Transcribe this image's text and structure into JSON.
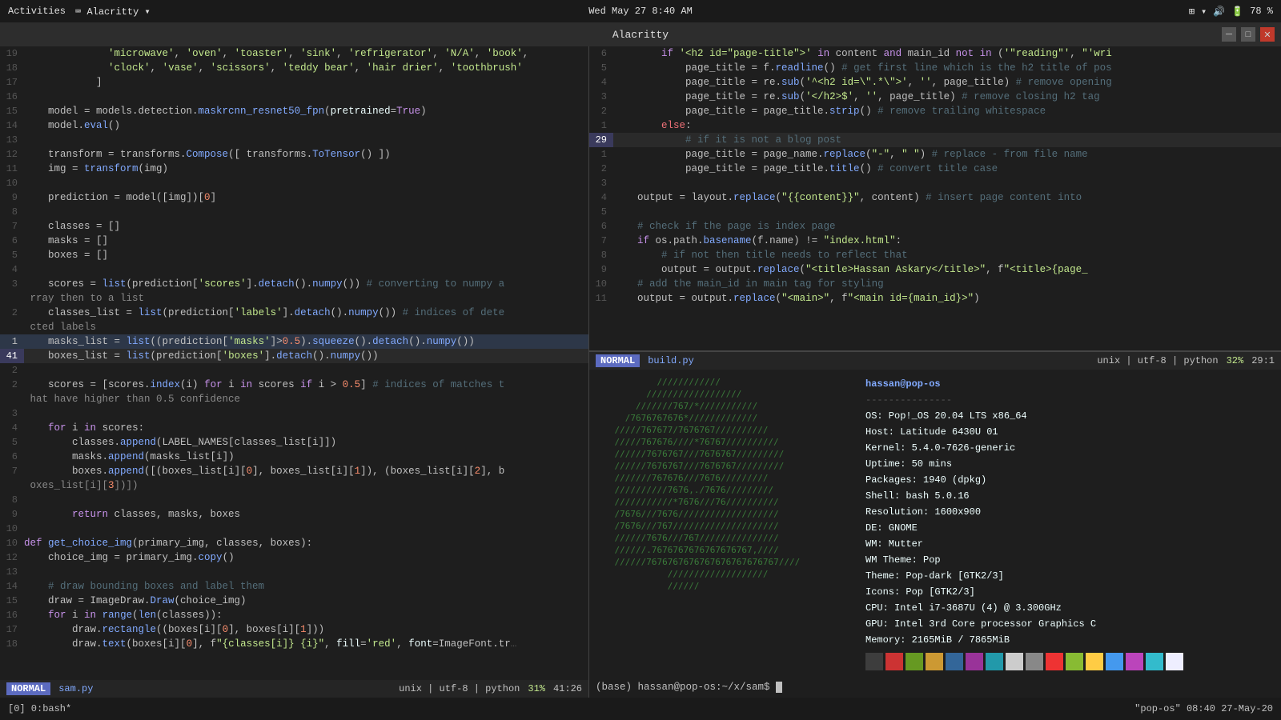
{
  "system_bar": {
    "activities": "Activities",
    "app_name": "Alacritty",
    "datetime": "Wed May 27  8:40 AM",
    "battery": "78 %"
  },
  "title_bar": {
    "title": "Alacritty"
  },
  "left_pane": {
    "status_mode": "NORMAL",
    "status_file": "sam.py",
    "status_encoding": "unix | utf-8 | python",
    "status_percent": "31%",
    "status_pos": "41:26"
  },
  "right_pane": {
    "status_mode": "NORMAL",
    "status_file": "build.py",
    "status_encoding": "unix | utf-8 | python",
    "status_percent": "32%",
    "status_pos": "29:1"
  },
  "sysinfo": {
    "username": "hassan@pop-os",
    "divider": "---------------",
    "os": "OS:  Pop!_OS 20.04 LTS x86_64",
    "host": "Host:  Latitude 6430U 01",
    "kernel": "Kernel:  5.4.0-7626-generic",
    "uptime": "Uptime:  50 mins",
    "packages": "Packages:  1940 (dpkg)",
    "shell": "Shell:  bash 5.0.16",
    "resolution": "Resolution:  1600x900",
    "de": "DE:  GNOME",
    "wm": "WM:  Mutter",
    "wm_theme": "WM Theme:  Pop",
    "theme": "Theme:  Pop-dark [GTK2/3]",
    "icons": "Icons:  Pop [GTK2/3]",
    "cpu": "CPU:  Intel i7-3687U (4) @ 3.300GHz",
    "gpu": "GPU:  Intel 3rd Core processor Graphics C",
    "memory": "Memory:  2165MiB / 7865MiB"
  },
  "color_swatches": [
    "#3d3d3d",
    "#cc3333",
    "#669922",
    "#cc9933",
    "#336699",
    "#993399",
    "#2299aa",
    "#cccccc",
    "#888888",
    "#ee3333",
    "#88bb33",
    "#ffcc44",
    "#4499ee",
    "#bb44bb",
    "#33bbcc",
    "#eeeeff"
  ],
  "bottom_bar": {
    "left": "[0] 0:bash*",
    "right": "\"pop-os\"  08:40  27-May-20"
  },
  "terminal_prompt": "(base) hassan@pop-os:~/x/sam$ "
}
